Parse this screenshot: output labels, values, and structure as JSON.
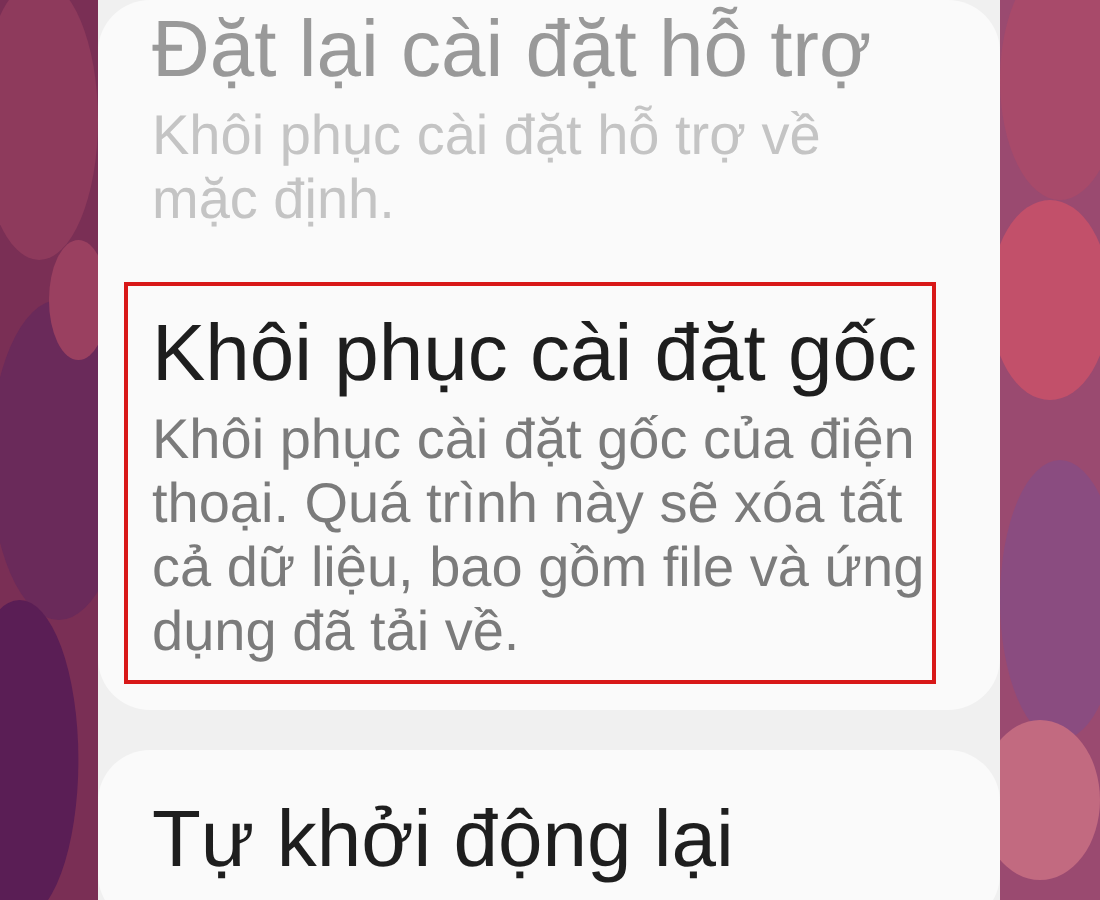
{
  "cards": [
    {
      "items": [
        {
          "title": "Đặt lại cài đặt hỗ trợ",
          "description": "Khôi phục cài đặt hỗ trợ về mặc định.",
          "disabled": true,
          "highlighted": false
        },
        {
          "title": "Khôi phục cài đặt gốc",
          "description": "Khôi phục cài đặt gốc của điện thoại. Quá trình này sẽ xóa tất cả dữ liệu, bao gồm file và ứng dụng đã tải về.",
          "disabled": false,
          "highlighted": true
        }
      ]
    },
    {
      "items": [
        {
          "title": "Tự khởi động lại",
          "disabled": false,
          "highlighted": false
        }
      ]
    }
  ]
}
